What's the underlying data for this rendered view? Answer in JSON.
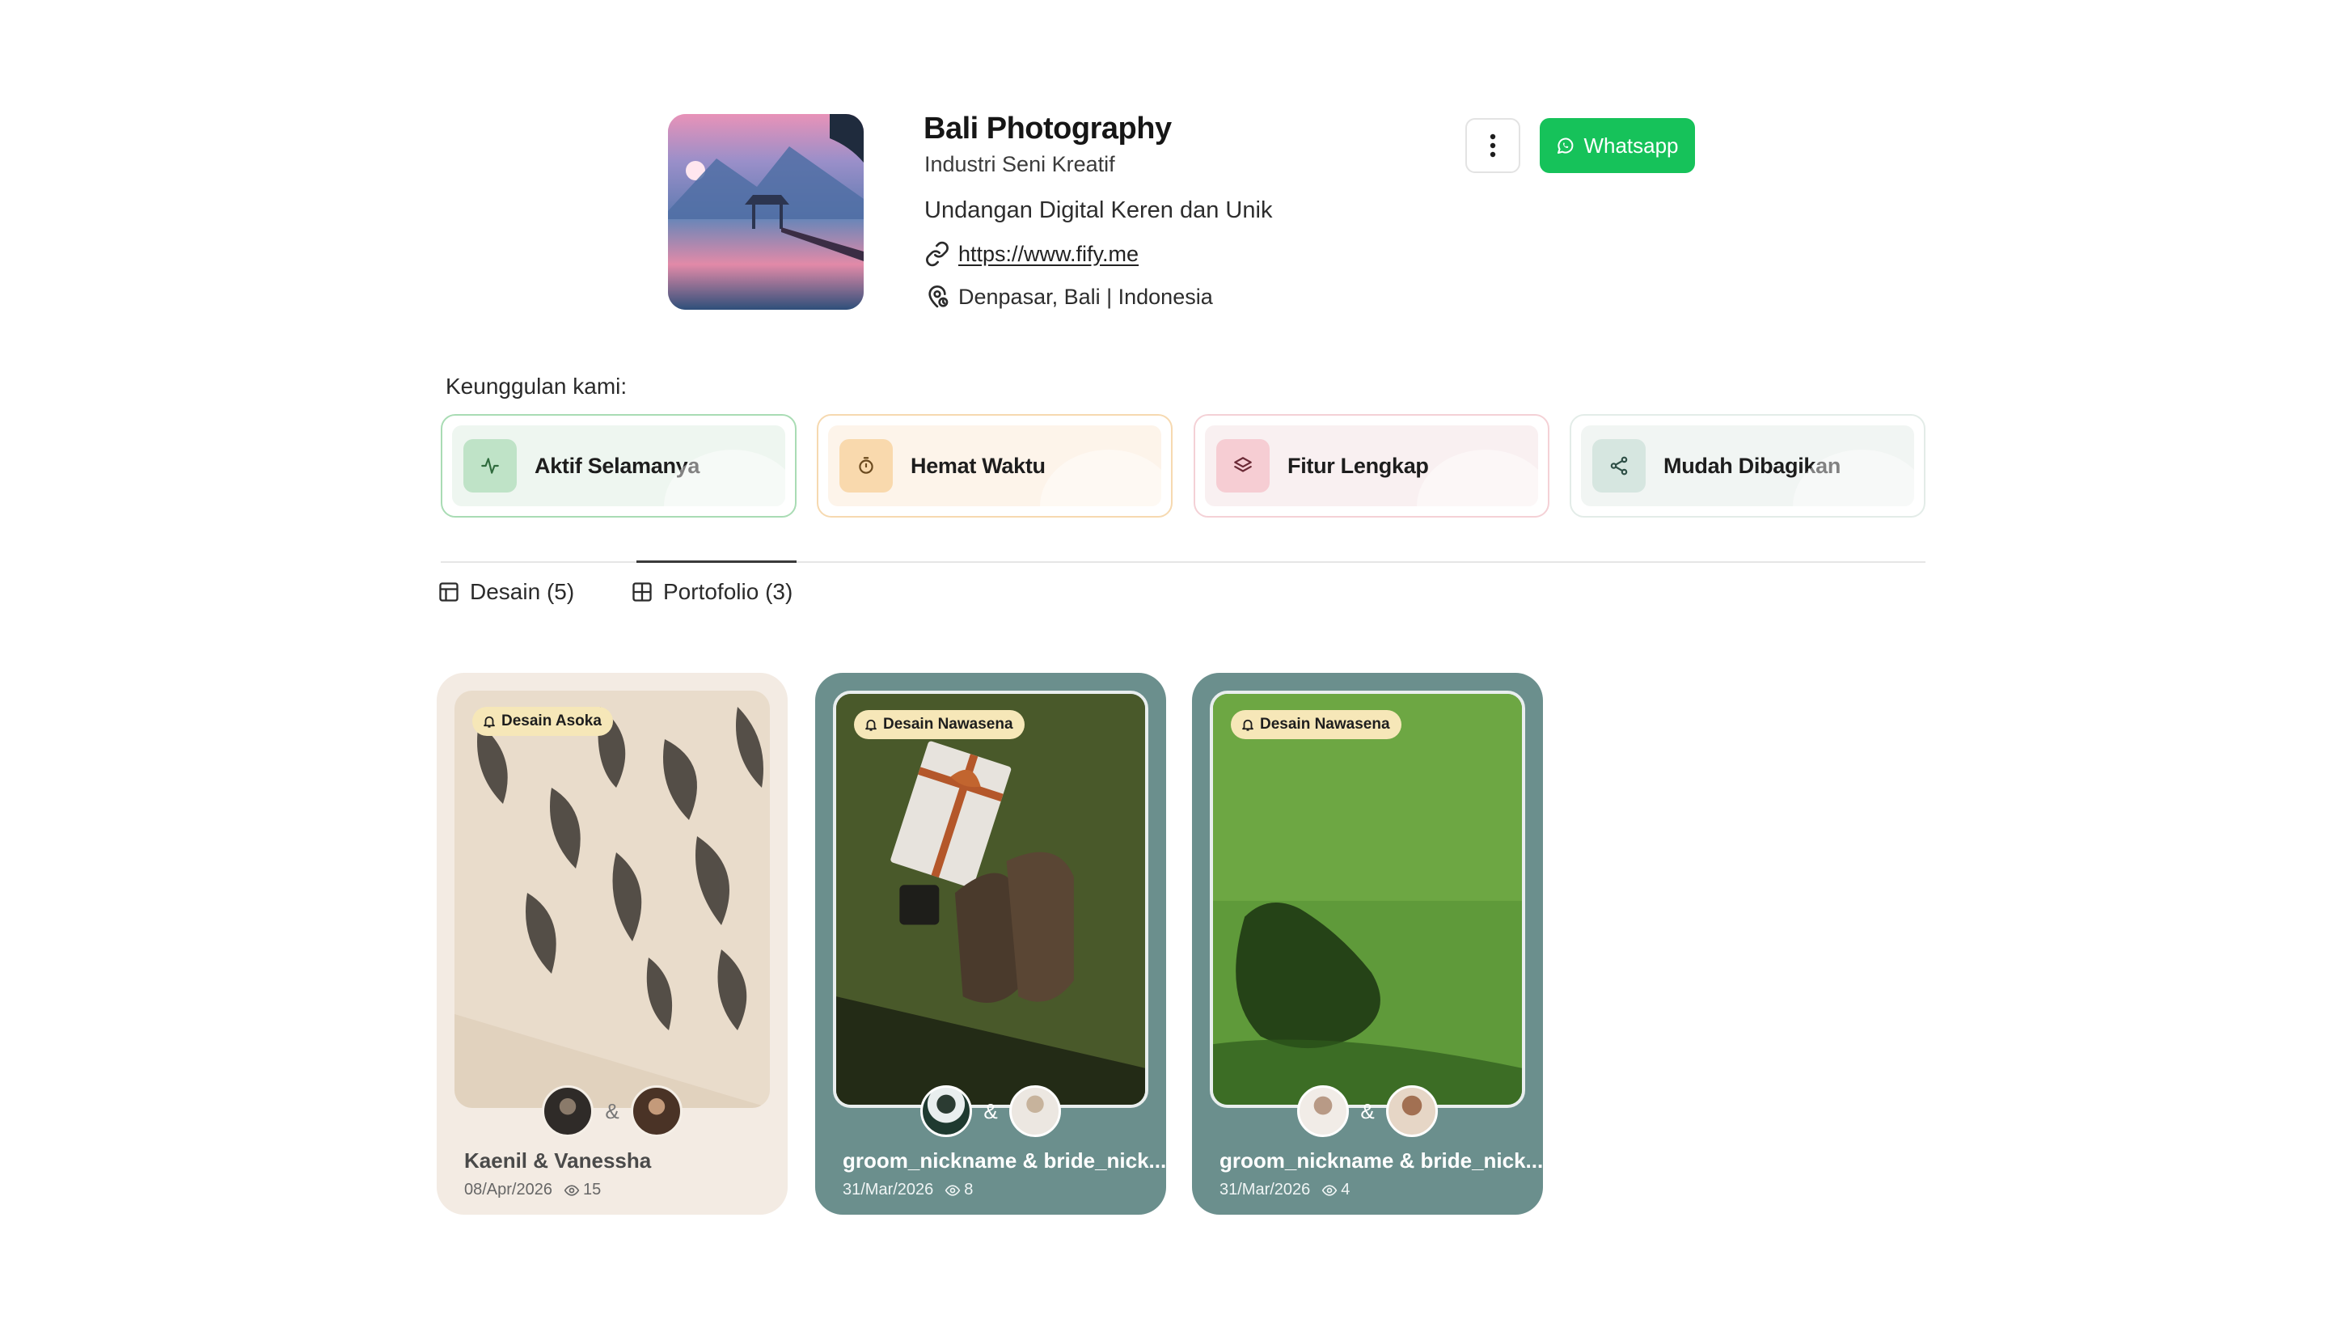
{
  "profile": {
    "name": "Bali Photography",
    "industry": "Industri Seni Kreatif",
    "tagline": "Undangan Digital Keren dan Unik",
    "website": "https://www.fify.me",
    "location": "Denpasar, Bali | Indonesia",
    "more_icon": "more-vertical-icon",
    "whatsapp_label": "Whatsapp",
    "whatsapp_color": "#16c25a"
  },
  "advantages": {
    "title": "Keunggulan kami:",
    "items": [
      {
        "label": "Aktif Selamanya",
        "icon": "activity-icon",
        "accent": "#8fcf9d"
      },
      {
        "label": "Hemat Waktu",
        "icon": "timer-icon",
        "accent": "#f3c98e"
      },
      {
        "label": "Fitur Lengkap",
        "icon": "layers-icon",
        "accent": "#f1b7c0"
      },
      {
        "label": "Mudah Dibagikan",
        "icon": "share-icon",
        "accent": "#c9ddd6"
      }
    ]
  },
  "tabs": [
    {
      "label": "Desain (5)",
      "icon": "layout-icon",
      "active": false
    },
    {
      "label": "Portofolio (3)",
      "icon": "grid-icon",
      "active": true
    }
  ],
  "portfolio": [
    {
      "badge": "Desain Asoka",
      "title": "Kaenil & Vanessha",
      "date": "08/Apr/2026",
      "views": "15",
      "amp": "&",
      "theme": "light"
    },
    {
      "badge": "Desain Nawasena",
      "title": "groom_nickname & bride_nick...",
      "date": "31/Mar/2026",
      "views": "8",
      "amp": "&",
      "theme": "teal"
    },
    {
      "badge": "Desain Nawasena",
      "title": "groom_nickname & bride_nick...",
      "date": "31/Mar/2026",
      "views": "4",
      "amp": "&",
      "theme": "teal"
    }
  ]
}
